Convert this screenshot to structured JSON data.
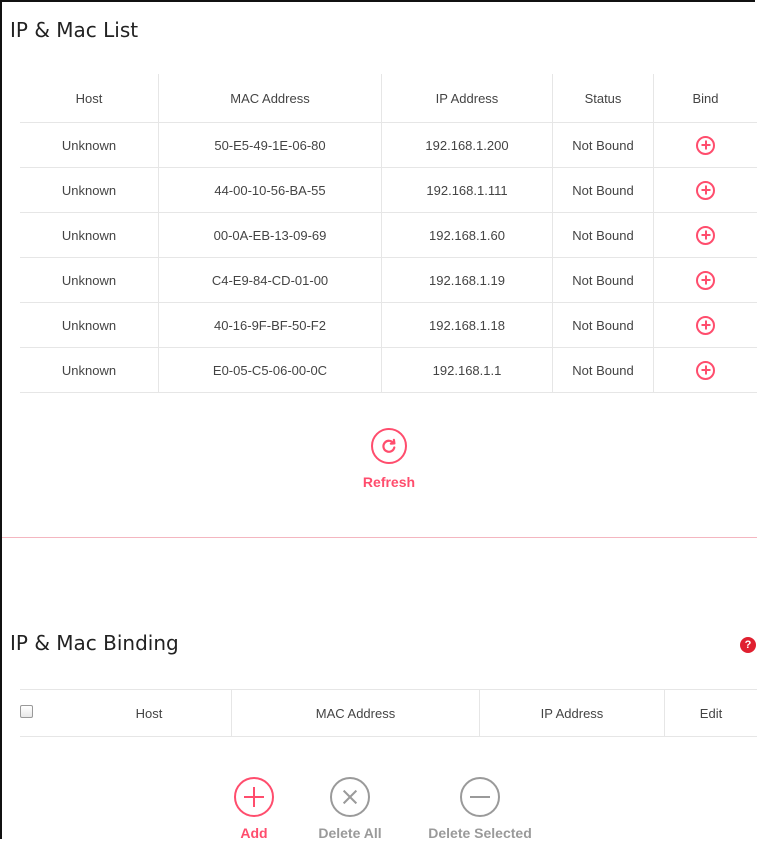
{
  "ip_mac_list": {
    "title": "IP & Mac List",
    "columns": [
      "Host",
      "MAC Address",
      "IP Address",
      "Status",
      "Bind"
    ],
    "rows": [
      {
        "host": "Unknown",
        "mac": "50-E5-49-1E-06-80",
        "ip": "192.168.1.200",
        "status": "Not Bound"
      },
      {
        "host": "Unknown",
        "mac": "44-00-10-56-BA-55",
        "ip": "192.168.1.111",
        "status": "Not Bound"
      },
      {
        "host": "Unknown",
        "mac": "00-0A-EB-13-09-69",
        "ip": "192.168.1.60",
        "status": "Not Bound"
      },
      {
        "host": "Unknown",
        "mac": "C4-E9-84-CD-01-00",
        "ip": "192.168.1.19",
        "status": "Not Bound"
      },
      {
        "host": "Unknown",
        "mac": "40-16-9F-BF-50-F2",
        "ip": "192.168.1.18",
        "status": "Not Bound"
      },
      {
        "host": "Unknown",
        "mac": "E0-05-C5-06-00-0C",
        "ip": "192.168.1.1",
        "status": "Not Bound"
      }
    ],
    "refresh_label": "Refresh"
  },
  "ip_mac_binding": {
    "title": "IP & Mac Binding",
    "help_icon": "question-icon",
    "columns": [
      "Host",
      "MAC Address",
      "IP Address",
      "Edit"
    ],
    "actions": {
      "add_label": "Add",
      "delete_all_label": "Delete All",
      "delete_selected_label": "Delete Selected"
    }
  },
  "colors": {
    "accent": "#ff4d6d",
    "muted": "#9a9a9a",
    "help": "#e02030"
  }
}
